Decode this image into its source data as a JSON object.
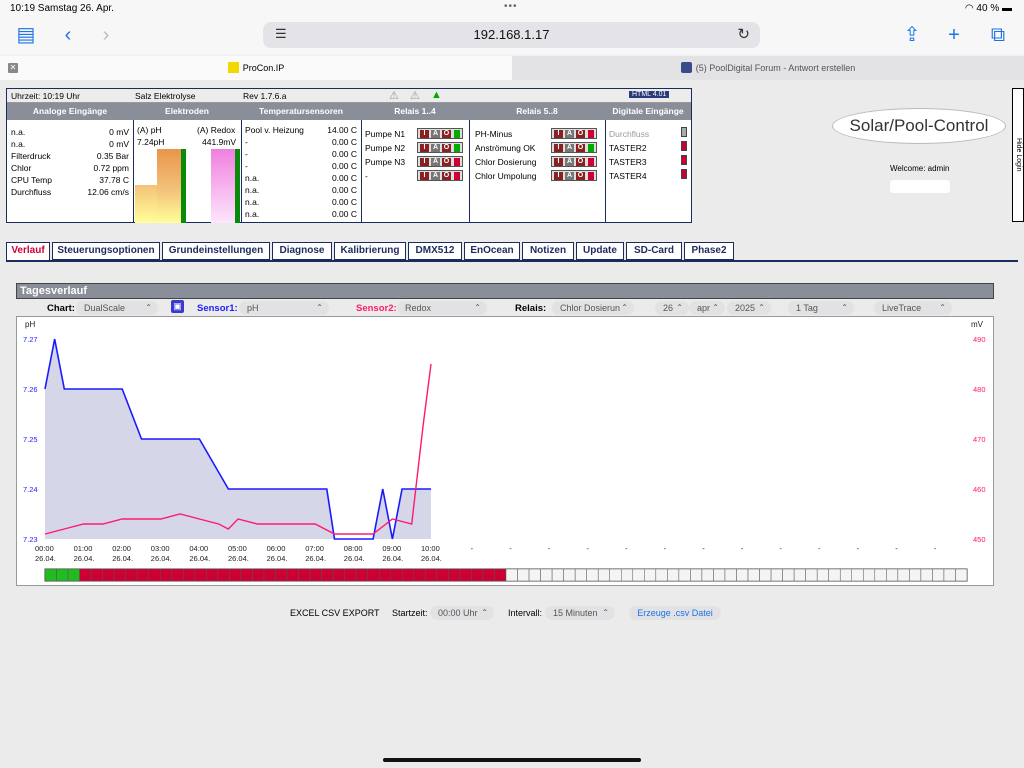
{
  "status": {
    "time_date": "10:19  Samstag 26. Apr.",
    "battery": "40 %",
    "dots": "•••"
  },
  "browser": {
    "url": "192.168.1.17",
    "tab1": "ProCon.IP",
    "tab2": "(5) PoolDigital Forum - Antwort erstellen"
  },
  "panel": {
    "uhrzeit": "Uhrzeit: 10:19 Uhr",
    "mode": "Salz Elektrolyse",
    "rev": "Rev 1.7.6.a",
    "html_badge": "HTML 4.01",
    "headers": [
      "Analoge Eingänge",
      "Elektroden",
      "Temperatursensoren",
      "Relais 1..4",
      "Relais 5..8",
      "Digitale Eingänge"
    ],
    "analog": [
      {
        "name": "n.a.",
        "value": "0 mV"
      },
      {
        "name": "n.a.",
        "value": "0 mV"
      },
      {
        "name": "Filterdruck",
        "value": "0.35 Bar"
      },
      {
        "name": "Chlor",
        "value": "0.72 ppm"
      },
      {
        "name": "CPU Temp",
        "value": "37.78 C"
      },
      {
        "name": "Durchfluss",
        "value": "12.06 cm/s"
      }
    ],
    "electrodes": {
      "ph_label": "(A) pH",
      "ph_value": "7.24pH",
      "redox_label": "(A) Redox",
      "redox_value": "441.9mV"
    },
    "temps": [
      {
        "name": "Pool v. Heizung",
        "value": "14.00 C"
      },
      {
        "name": "-",
        "value": "0.00 C"
      },
      {
        "name": "-",
        "value": "0.00 C"
      },
      {
        "name": "-",
        "value": "0.00 C"
      },
      {
        "name": "n.a.",
        "value": "0.00 C"
      },
      {
        "name": "n.a.",
        "value": "0.00 C"
      },
      {
        "name": "n.a.",
        "value": "0.00 C"
      },
      {
        "name": "n.a.",
        "value": "0.00 C"
      }
    ],
    "relais1": [
      "Pumpe N1",
      "Pumpe N2",
      "Pumpe N3",
      "-"
    ],
    "relais2": [
      "PH-Minus",
      "Anströmung OK",
      "Chlor Dosierung",
      "Chlor Umpolung"
    ],
    "digital": [
      "Durchfluss",
      "TASTER2",
      "TASTER3",
      "TASTER4"
    ],
    "relay_letters": [
      "I",
      "A",
      "O"
    ]
  },
  "logo": "Solar/Pool-Control",
  "welcome": "Welcome:  admin",
  "hide_login": "Hide Login",
  "nav_tabs": [
    "Verlauf",
    "Steuerungsoptionen",
    "Grundeinstellungen",
    "Diagnose",
    "Kalibrierung",
    "DMX512",
    "EnOcean",
    "Notizen",
    "Update",
    "SD-Card",
    "Phase2"
  ],
  "tagesverlauf": "Tagesverlauf",
  "controls": {
    "chart_label": "Chart:",
    "chart_value": "DualScale",
    "sensor1_label": "Sensor1:",
    "sensor1_value": "pH",
    "sensor2_label": "Sensor2:",
    "sensor2_value": "Redox",
    "relais_label": "Relais:",
    "relais_value": "Chlor Dosierun",
    "day": "26",
    "month": "apr",
    "year": "2025",
    "range": "1 Tag",
    "mode": "LiveTrace"
  },
  "csv": {
    "label": "EXCEL CSV EXPORT",
    "start_label": "Startzeit:",
    "start_value": "00:00 Uhr",
    "interval_label": "Intervall:",
    "interval_value": "15 Minuten",
    "button": "Erzeuge .csv Datei"
  },
  "colors": {
    "navy": "#1c2b5e",
    "ph_line": "#1a1aff",
    "redox_line": "#ff1a6e",
    "relay_on": "#cc0033",
    "relay_off": "#00aa00"
  },
  "chart_data": {
    "type": "line",
    "ylabel_left": "pH",
    "ylabel_right": "mV",
    "ylim_left": [
      7.23,
      7.27
    ],
    "ylim_right": [
      450,
      490
    ],
    "yticks_left": [
      "7.27",
      "7.26",
      "7.25",
      "7.24",
      "7.23"
    ],
    "yticks_right": [
      "490",
      "480",
      "470",
      "460",
      "450"
    ],
    "xticks": [
      "00:00",
      "01:00",
      "02:00",
      "03:00",
      "04:00",
      "05:00",
      "06:00",
      "07:00",
      "08:00",
      "09:00",
      "10:00",
      "-",
      "-",
      "-",
      "-",
      "-",
      "-",
      "-",
      "-",
      "-",
      "-",
      "-",
      "-",
      "-"
    ],
    "xtick_dates": [
      "26.04.",
      "26.04.",
      "26.04.",
      "26.04.",
      "26.04.",
      "26.04.",
      "26.04.",
      "26.04.",
      "26.04.",
      "26.04.",
      "26.04."
    ],
    "series": [
      {
        "axis": "left",
        "x": [
          0,
          0.25,
          0.5,
          1,
          2,
          2.5,
          3,
          4,
          4.75,
          5,
          6,
          7,
          7.3,
          7.5,
          8,
          8.5,
          8.75,
          9,
          9.25,
          10
        ],
        "values": [
          7.26,
          7.27,
          7.26,
          7.26,
          7.26,
          7.25,
          7.25,
          7.25,
          7.24,
          7.24,
          7.24,
          7.24,
          7.24,
          7.23,
          7.23,
          7.23,
          7.24,
          7.23,
          7.24,
          7.24
        ]
      },
      {
        "axis": "right",
        "x": [
          0,
          0.5,
          1,
          1.5,
          2,
          2.5,
          3,
          3.5,
          4,
          4.5,
          4.75,
          5,
          5.5,
          6,
          6.5,
          7,
          7.5,
          8,
          8.5,
          9,
          9.5,
          9.8,
          10
        ],
        "values": [
          451,
          452,
          453,
          453,
          454,
          454,
          454,
          455,
          454,
          453,
          452,
          454,
          453,
          453,
          453,
          453,
          451,
          451,
          451,
          454,
          453,
          473,
          485
        ]
      }
    ],
    "relay_bar": {
      "on_segments": 3,
      "red_segments": 37,
      "empty_segments": 40
    }
  }
}
